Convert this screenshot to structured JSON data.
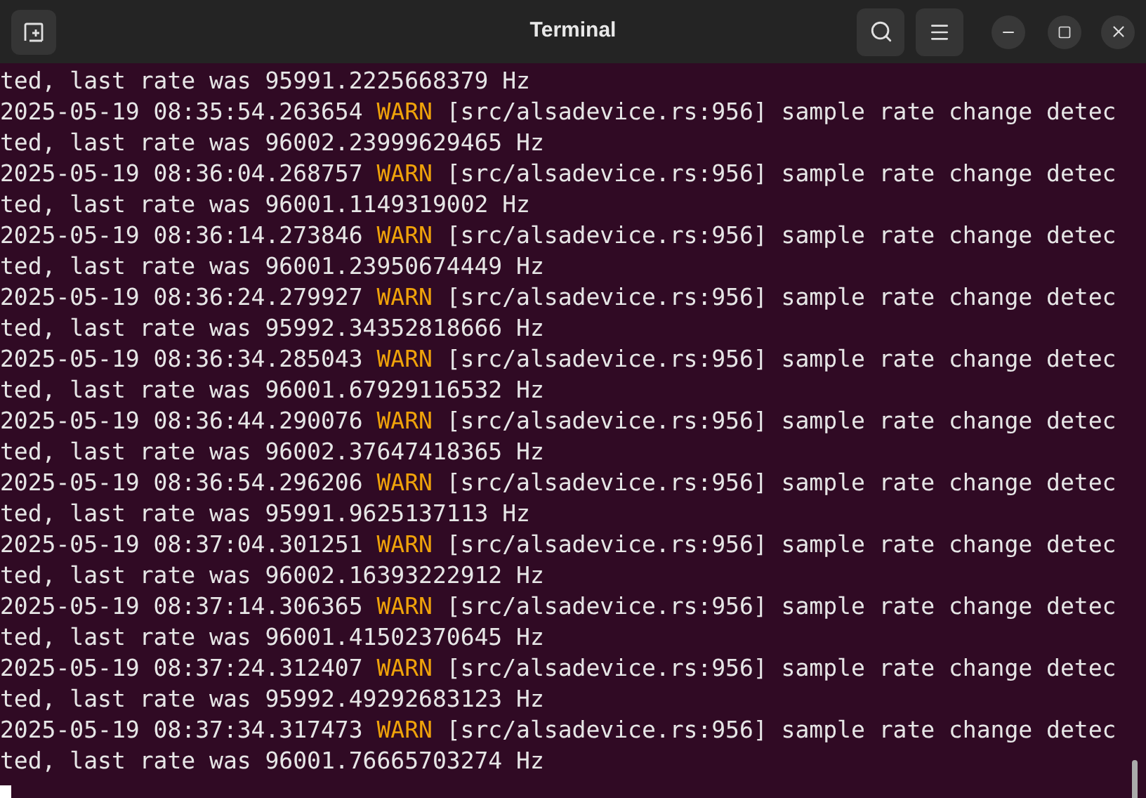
{
  "window": {
    "title": "Terminal"
  },
  "lines": [
    {
      "kind": "plain",
      "text": "ted, last rate was 95991.2225668379 Hz"
    },
    {
      "kind": "log",
      "timestamp": "2025-05-19 08:35:54.263654",
      "severity": "WARN",
      "message": "[src/alsadevice.rs:956] sample rate change detec"
    },
    {
      "kind": "plain",
      "text": "ted, last rate was 96002.23999629465 Hz"
    },
    {
      "kind": "log",
      "timestamp": "2025-05-19 08:36:04.268757",
      "severity": "WARN",
      "message": "[src/alsadevice.rs:956] sample rate change detec"
    },
    {
      "kind": "plain",
      "text": "ted, last rate was 96001.1149319002 Hz"
    },
    {
      "kind": "log",
      "timestamp": "2025-05-19 08:36:14.273846",
      "severity": "WARN",
      "message": "[src/alsadevice.rs:956] sample rate change detec"
    },
    {
      "kind": "plain",
      "text": "ted, last rate was 96001.23950674449 Hz"
    },
    {
      "kind": "log",
      "timestamp": "2025-05-19 08:36:24.279927",
      "severity": "WARN",
      "message": "[src/alsadevice.rs:956] sample rate change detec"
    },
    {
      "kind": "plain",
      "text": "ted, last rate was 95992.34352818666 Hz"
    },
    {
      "kind": "log",
      "timestamp": "2025-05-19 08:36:34.285043",
      "severity": "WARN",
      "message": "[src/alsadevice.rs:956] sample rate change detec"
    },
    {
      "kind": "plain",
      "text": "ted, last rate was 96001.67929116532 Hz"
    },
    {
      "kind": "log",
      "timestamp": "2025-05-19 08:36:44.290076",
      "severity": "WARN",
      "message": "[src/alsadevice.rs:956] sample rate change detec"
    },
    {
      "kind": "plain",
      "text": "ted, last rate was 96002.37647418365 Hz"
    },
    {
      "kind": "log",
      "timestamp": "2025-05-19 08:36:54.296206",
      "severity": "WARN",
      "message": "[src/alsadevice.rs:956] sample rate change detec"
    },
    {
      "kind": "plain",
      "text": "ted, last rate was 95991.9625137113 Hz"
    },
    {
      "kind": "log",
      "timestamp": "2025-05-19 08:37:04.301251",
      "severity": "WARN",
      "message": "[src/alsadevice.rs:956] sample rate change detec"
    },
    {
      "kind": "plain",
      "text": "ted, last rate was 96002.16393222912 Hz"
    },
    {
      "kind": "log",
      "timestamp": "2025-05-19 08:37:14.306365",
      "severity": "WARN",
      "message": "[src/alsadevice.rs:956] sample rate change detec"
    },
    {
      "kind": "plain",
      "text": "ted, last rate was 96001.41502370645 Hz"
    },
    {
      "kind": "log",
      "timestamp": "2025-05-19 08:37:24.312407",
      "severity": "WARN",
      "message": "[src/alsadevice.rs:956] sample rate change detec"
    },
    {
      "kind": "plain",
      "text": "ted, last rate was 95992.49292683123 Hz"
    },
    {
      "kind": "log",
      "timestamp": "2025-05-19 08:37:34.317473",
      "severity": "WARN",
      "message": "[src/alsadevice.rs:956] sample rate change detec"
    },
    {
      "kind": "plain",
      "text": "ted, last rate was 96001.76665703274 Hz"
    }
  ]
}
